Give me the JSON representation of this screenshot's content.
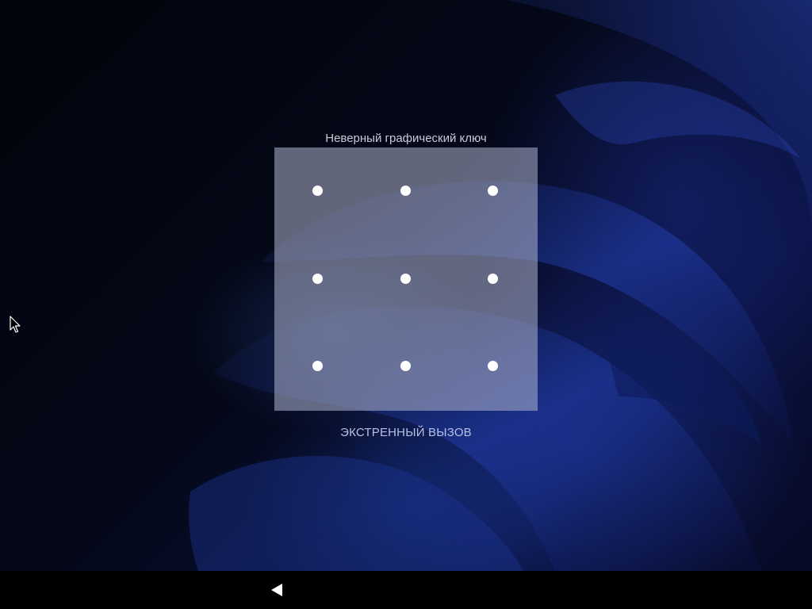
{
  "lockscreen": {
    "status_message": "Неверный графический ключ",
    "emergency_call_label": "ЭКСТРЕННЫЙ ВЫЗОВ",
    "pattern_dots": [
      {
        "row": 1,
        "col": 1
      },
      {
        "row": 1,
        "col": 2
      },
      {
        "row": 1,
        "col": 3
      },
      {
        "row": 2,
        "col": 1
      },
      {
        "row": 2,
        "col": 2
      },
      {
        "row": 2,
        "col": 3
      },
      {
        "row": 3,
        "col": 1
      },
      {
        "row": 3,
        "col": 2
      },
      {
        "row": 3,
        "col": 3
      }
    ]
  },
  "navigation_bar": {
    "back_icon": "back-triangle-icon"
  },
  "colors": {
    "pad_overlay": "#afb4cd",
    "dot": "#ffffff",
    "emergency_text": "#b8c0e6",
    "status_text": "#c9ccd6",
    "navbar": "#000000"
  }
}
